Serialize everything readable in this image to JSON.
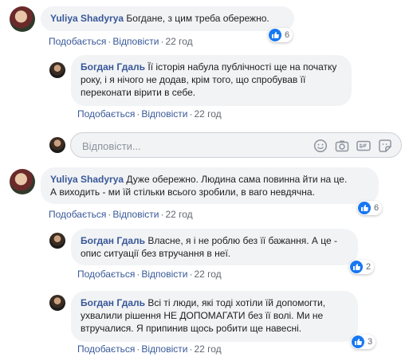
{
  "comments": [
    {
      "author": "Yuliya Shadyrya",
      "text": "Богдане, з цим треба обережно.",
      "like_label": "Подобається",
      "reply_label": "Відповісти",
      "time": "22 год",
      "reactions": "6"
    },
    {
      "author": "Богдан Гдаль",
      "text_lines": [
        "Її історія набула публічності ще на початку",
        "року, і я нічого не додав, крім того, що спробував її",
        "переконати вірити в себе."
      ],
      "like_label": "Подобається",
      "reply_label": "Відповісти",
      "time": "22 год"
    },
    {
      "author": "Yuliya Shadyrya",
      "text_lines": [
        "Дуже обережно. Людина сама повинна йти на це.",
        "А виходить - ми їй стільки всього зробили, в ваго невдячна."
      ],
      "like_label": "Подобається",
      "reply_label": "Відповісти",
      "time": "22 год",
      "reactions": "6"
    },
    {
      "author": "Богдан Гдаль",
      "text_lines": [
        "Власне, я і не роблю без її бажання. А це -",
        "опис ситуації без втручання в неї."
      ],
      "like_label": "Подобається",
      "reply_label": "Відповісти",
      "time": "22 год",
      "reactions": "2"
    },
    {
      "author": "Богдан Гдаль",
      "text_lines": [
        "Всі ті люди, які тоді хотіли їй допомогти,",
        "ухвалили рішення НЕ ДОПОМАГАТИ без її волі. Ми не",
        "втручалися. Я припинив щось робити ще навесні."
      ],
      "like_label": "Подобається",
      "reply_label": "Відповісти",
      "time": "22 год",
      "reactions": "3"
    }
  ],
  "reply_box": {
    "placeholder": "Відповісти...",
    "icons": [
      "emoji-icon",
      "camera-icon",
      "gif-icon",
      "sticker-icon"
    ]
  },
  "colors": {
    "link": "#385898",
    "bubble": "#f2f3f5",
    "like_blue": "#1877f2",
    "meta_gray": "#606770"
  }
}
